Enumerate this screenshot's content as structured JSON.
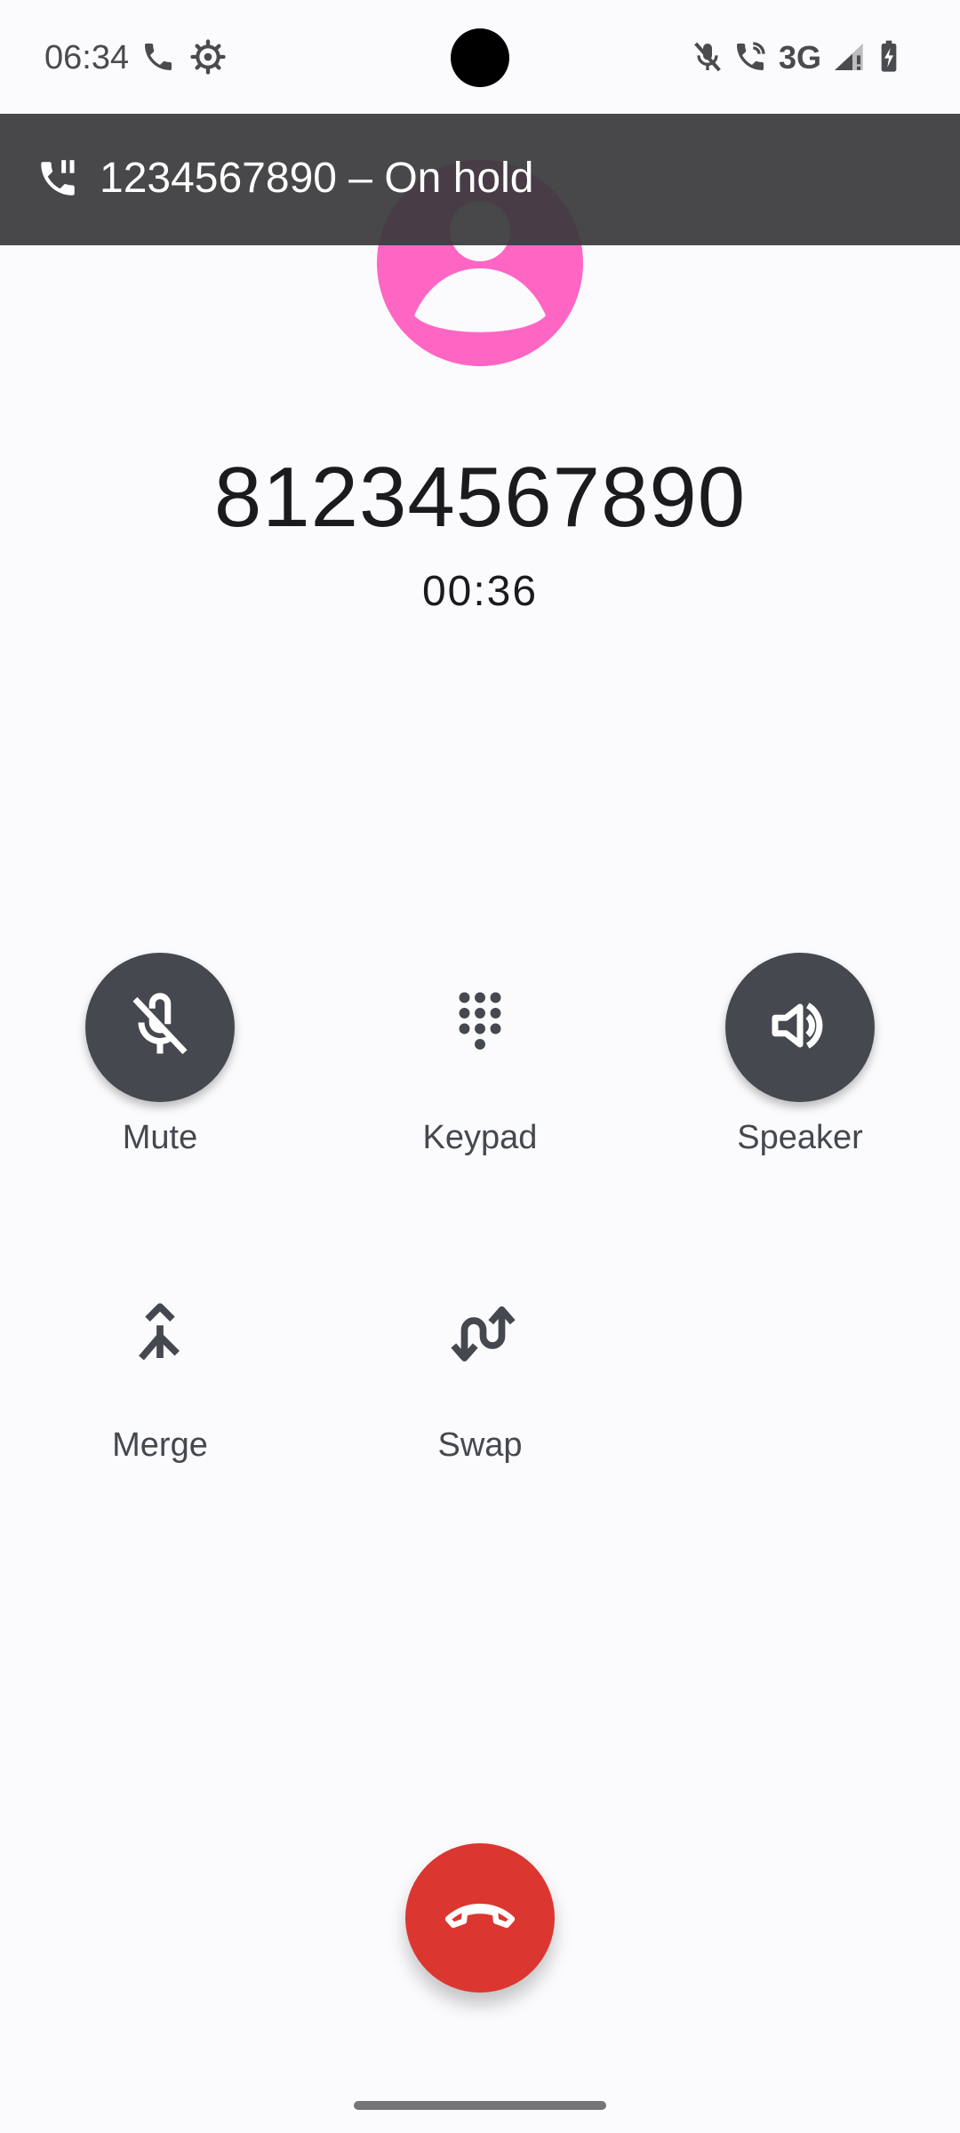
{
  "status_bar": {
    "time": "06:34",
    "network": "3G",
    "icons": [
      "phone-icon",
      "settings-gear-icon",
      "mic-muted-icon",
      "wifi-calling-icon",
      "signal-icon",
      "battery-charging-icon"
    ]
  },
  "hold_banner": {
    "text": "1234567890 – On hold",
    "icon": "phone-paused-icon"
  },
  "caller": {
    "number": "81234567890",
    "timer": "00:36",
    "avatar_color": "#ff66c4"
  },
  "controls": {
    "mute": {
      "label": "Mute",
      "active": true,
      "icon": "mic-off-icon"
    },
    "keypad": {
      "label": "Keypad",
      "active": false,
      "icon": "dialpad-icon"
    },
    "speaker": {
      "label": "Speaker",
      "active": true,
      "icon": "volume-icon"
    },
    "merge": {
      "label": "Merge",
      "active": false,
      "icon": "merge-icon"
    },
    "swap": {
      "label": "Swap",
      "active": false,
      "icon": "swap-calls-icon"
    }
  },
  "end_call": {
    "icon": "call-end-icon",
    "color": "#dc3630"
  },
  "colors": {
    "background": "#fbfbfd",
    "active_button": "#45484f",
    "banner": "#3a3a3c"
  }
}
